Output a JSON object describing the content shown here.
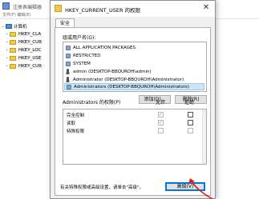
{
  "background_window": {
    "title": "注册表编辑器",
    "menu": "文件(F) 编辑(E)",
    "tree": {
      "computer_label": "计算机",
      "keys": [
        "HKEY_CLA",
        "HKEY_CUR",
        "HKEY_LOC",
        "HKEY_USE",
        "HKEY_CUR"
      ]
    }
  },
  "dialog": {
    "title": "HKEY_CURRENT_USER 的权限",
    "close_glyph": "✕",
    "tab": "安全",
    "groups_label": "组或用户名(G):",
    "principals": [
      {
        "name": "ALL APPLICATION PACKAGES",
        "icon": "group-icon",
        "selected": false
      },
      {
        "name": "RESTRICTED",
        "icon": "group-icon",
        "selected": false
      },
      {
        "name": "SYSTEM",
        "icon": "group-icon",
        "selected": false
      },
      {
        "name": "admin (DESKTOP-BBQUROH\\admin)",
        "icon": "user-icon",
        "selected": false
      },
      {
        "name": "Administrator (DESKTOP-BBQUROH\\Administrator)",
        "icon": "user-icon",
        "selected": false
      },
      {
        "name": "Administrators (DESKTOP-BBQUROH\\Administrators)",
        "icon": "group-icon",
        "selected": true
      }
    ],
    "add_button": "添加(D)...",
    "remove_button": "删除(R)",
    "perm_header": "Administrators 的权限(P)",
    "allow_header": "允许",
    "deny_header": "拒绝",
    "permissions": [
      {
        "name": "完全控制",
        "allow": true,
        "deny": false
      },
      {
        "name": "读取",
        "allow": true,
        "deny": false
      },
      {
        "name": "特殊权限",
        "allow": false,
        "deny": false
      }
    ],
    "note": "有关特殊权限或高级设置，请单击\"高级\"。",
    "advanced_button": "高级(V)",
    "accent_color": "#0078d7",
    "selection_color": "#cce4f7",
    "annotation_color": "#e02020"
  }
}
